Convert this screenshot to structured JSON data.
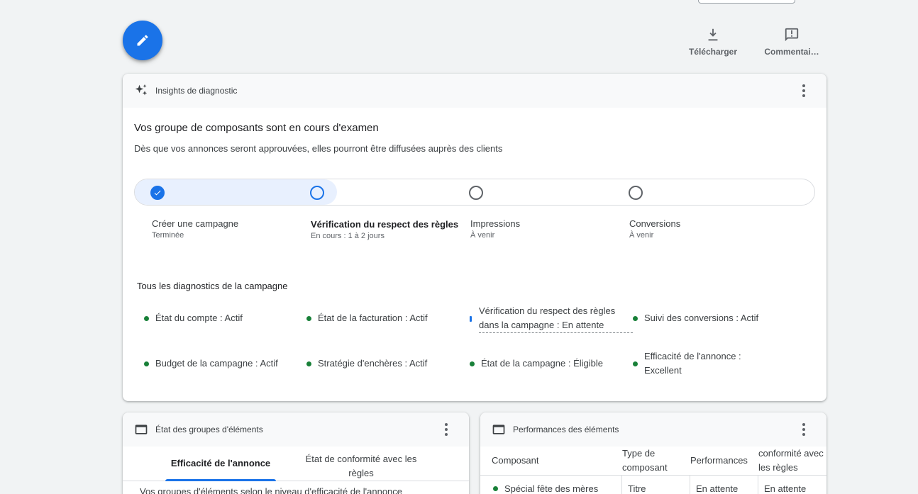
{
  "top_actions": {
    "download_label": "Télécharger",
    "comment_label": "Commentai…"
  },
  "insights": {
    "header": "Insights de diagnostic",
    "title": "Vos groupe de composants sont en cours d'examen",
    "subtitle": "Dès que vos annonces seront approuvées, elles pourront être diffusées auprès des clients",
    "steps": [
      {
        "title": "Créer une campagne",
        "status": "Terminée"
      },
      {
        "title": "Vérification du respect des règles",
        "status": "En cours : 1 à 2 jours"
      },
      {
        "title": "Impressions",
        "status": "À venir"
      },
      {
        "title": "Conversions",
        "status": "À venir"
      }
    ],
    "diagnostics_title": "Tous les diagnostics de la campagne",
    "diagnostics": [
      "État du compte : Actif",
      "État de la facturation : Actif",
      "Vérification du respect des règles dans la campagne : En attente",
      "Suivi des conversions : Actif",
      "Budget de la campagne : Actif",
      "Stratégie d'enchères : Actif",
      "État de la campagne : Éligible",
      "Efficacité de l'annonce : Excellent"
    ]
  },
  "groups": {
    "header": "État des groupes d'éléments",
    "tabs": [
      "Efficacité de l'annonce",
      "État de conformité avec les règles"
    ],
    "description": "Vos groupes d'éléments selon le niveau d'efficacité de l'annonce"
  },
  "performance": {
    "header": "Performances des éléments",
    "columns": [
      "Composant",
      "Type de composant",
      "Performances",
      "conformité avec les règles"
    ],
    "rows": [
      {
        "asset": "Spécial fête des mères",
        "type": "Titre",
        "performance": "En attente",
        "policy": "En attente"
      }
    ]
  },
  "colors": {
    "accent": "#1a73e8",
    "active_status": "#188038",
    "progress_fill": "#e8f0fe"
  }
}
